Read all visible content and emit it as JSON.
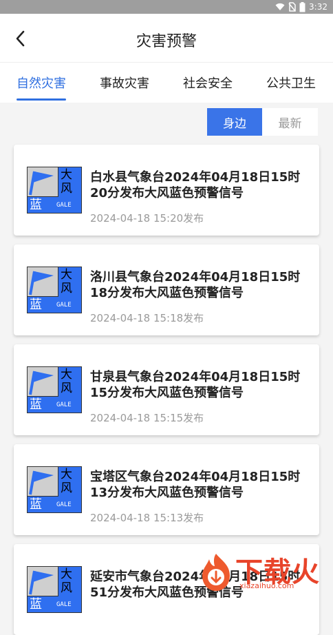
{
  "status": {
    "time": "3:32"
  },
  "header": {
    "title": "灾害预警"
  },
  "tabs": [
    {
      "label": "自然灾害",
      "active": true
    },
    {
      "label": "事故灾害",
      "active": false
    },
    {
      "label": "社会安全",
      "active": false
    },
    {
      "label": "公共卫生",
      "active": false
    }
  ],
  "toggle": {
    "near": "身边",
    "latest": "最新"
  },
  "badge": {
    "char1": "大",
    "char2": "风",
    "color_text": "蓝",
    "en": "GALE",
    "bg": "#2f6ff0"
  },
  "colors": {
    "accent": "#2f6fe0",
    "brand": "#e8442a"
  },
  "items": [
    {
      "title": "白水县气象台2024年04月18日15时20分发布大风蓝色预警信号",
      "time": "2024-04-18 15:20发布"
    },
    {
      "title": "洛川县气象台2024年04月18日15时18分发布大风蓝色预警信号",
      "time": "2024-04-18 15:18发布"
    },
    {
      "title": "甘泉县气象台2024年04月18日15时15分发布大风蓝色预警信号",
      "time": "2024-04-18 15:15发布"
    },
    {
      "title": "宝塔区气象台2024年04月18日15时13分发布大风蓝色预警信号",
      "time": "2024-04-18 15:13发布"
    },
    {
      "title": "延安市气象台2024年04月18日15时51分发布大风蓝色预警信号",
      "time": ""
    }
  ],
  "watermark": {
    "text": "下载火",
    "url": "xiazaihuo.com"
  }
}
